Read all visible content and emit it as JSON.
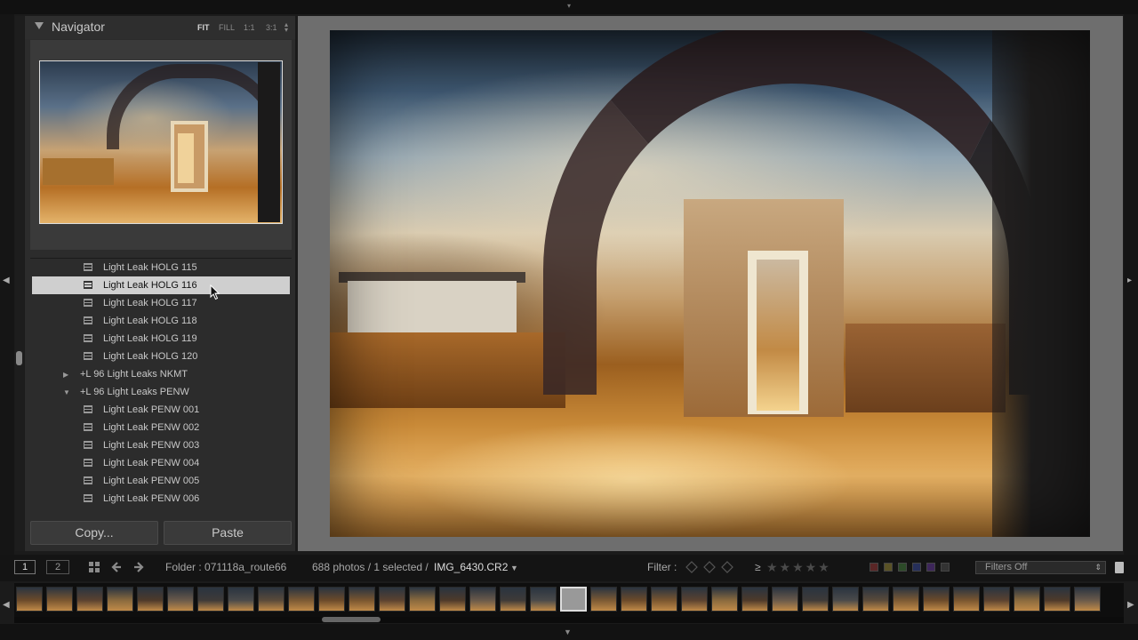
{
  "navigator": {
    "title": "Navigator",
    "zoom_options": [
      "FIT",
      "FILL",
      "1:1",
      "3:1"
    ]
  },
  "presets": {
    "rows": [
      {
        "type": "preset",
        "label": "Light Leak HOLG 115",
        "selected": false
      },
      {
        "type": "preset",
        "label": "Light Leak HOLG 116",
        "selected": true
      },
      {
        "type": "preset",
        "label": "Light Leak HOLG 117",
        "selected": false
      },
      {
        "type": "preset",
        "label": "Light Leak HOLG 118",
        "selected": false
      },
      {
        "type": "preset",
        "label": "Light Leak HOLG 119",
        "selected": false
      },
      {
        "type": "preset",
        "label": "Light Leak HOLG 120",
        "selected": false
      },
      {
        "type": "folder",
        "label": "+L 96 Light Leaks NKMT",
        "expanded": false
      },
      {
        "type": "folder",
        "label": "+L 96 Light Leaks PENW",
        "expanded": true
      },
      {
        "type": "preset",
        "label": "Light Leak PENW 001",
        "selected": false
      },
      {
        "type": "preset",
        "label": "Light Leak PENW 002",
        "selected": false
      },
      {
        "type": "preset",
        "label": "Light Leak PENW 003",
        "selected": false
      },
      {
        "type": "preset",
        "label": "Light Leak PENW 004",
        "selected": false
      },
      {
        "type": "preset",
        "label": "Light Leak PENW 005",
        "selected": false
      },
      {
        "type": "preset",
        "label": "Light Leak PENW 006",
        "selected": false
      }
    ]
  },
  "buttons": {
    "copy": "Copy...",
    "paste": "Paste"
  },
  "toolbar": {
    "view1": "1",
    "view2": "2",
    "folder": "Folder : 071118a_route66",
    "count": "688 photos / 1 selected /",
    "filename": "IMG_6430.CR2",
    "filter_label": "Filter :",
    "filters_value": "Filters Off",
    "star_prefix": "≥",
    "color_filters": [
      "#b33a3a",
      "#b8a23a",
      "#4f9a3f",
      "#3a5ab8",
      "#7a3ab8",
      "#555555"
    ]
  },
  "filmstrip": {
    "thumb_count": 36,
    "selected_index": 18
  }
}
